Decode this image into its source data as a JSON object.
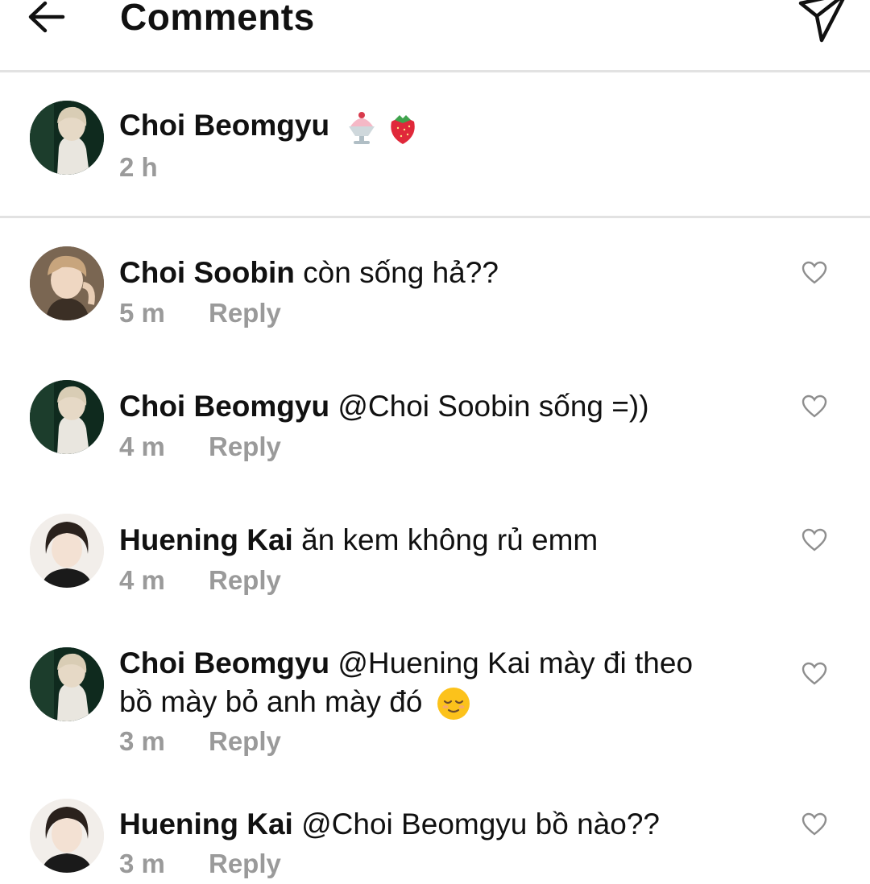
{
  "header": {
    "title": "Comments",
    "back_icon": "arrow-left-icon",
    "send_icon": "paper-plane-icon"
  },
  "caption": {
    "author": "Choi Beomgyu",
    "emojis": [
      "shaved-ice-icon",
      "strawberry-icon"
    ],
    "time": "2 h"
  },
  "comments": [
    {
      "author": "Choi Soobin",
      "text": "còn sống hả??",
      "time": "5 m",
      "reply_label": "Reply",
      "avatar": "soobin-avatar"
    },
    {
      "author": "Choi Beomgyu",
      "text": "@Choi Soobin sống =))",
      "time": "4 m",
      "reply_label": "Reply",
      "avatar": "beomgyu-avatar"
    },
    {
      "author": "Huening Kai",
      "text": "ăn kem không rủ emm",
      "time": "4 m",
      "reply_label": "Reply",
      "avatar": "kai-avatar"
    },
    {
      "author": "Choi Beomgyu",
      "text": "@Huening Kai mày đi theo",
      "text_line2": "bồ mày bỏ anh mày đó",
      "emoji": "relieved-face-icon",
      "time": "3 m",
      "reply_label": "Reply",
      "avatar": "beomgyu-avatar"
    },
    {
      "author": "Huening Kai",
      "text": "@Choi Beomgyu bồ nào??",
      "time": "3 m",
      "reply_label": "Reply",
      "avatar": "kai-avatar"
    }
  ],
  "colors": {
    "text": "#111111",
    "meta": "#9a9a9a",
    "divider": "#e2e2e2"
  }
}
